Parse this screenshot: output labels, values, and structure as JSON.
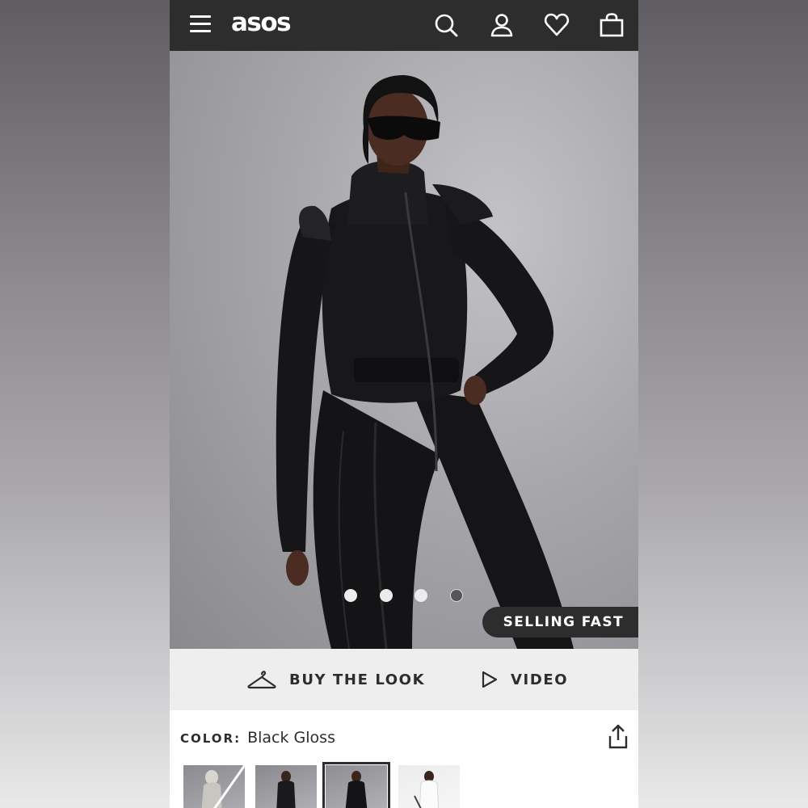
{
  "header": {
    "logo": "asos",
    "icons": [
      "hamburger-menu-icon",
      "search-icon",
      "account-icon",
      "heart-icon",
      "bag-icon"
    ],
    "background": "#2d2d2d"
  },
  "hero": {
    "carousel": {
      "total": 4,
      "active": 4
    },
    "badge": "SELLING FAST"
  },
  "actions": {
    "buy_the_look": "BUY THE LOOK",
    "video": "VIDEO"
  },
  "color": {
    "label": "COLOR:",
    "value": "Black Gloss"
  },
  "thumbnails": [
    {
      "variant": "grey",
      "unavailable": true
    },
    {
      "variant": "black"
    },
    {
      "variant": "black-gloss",
      "selected": true
    },
    {
      "variant": "white"
    }
  ]
}
